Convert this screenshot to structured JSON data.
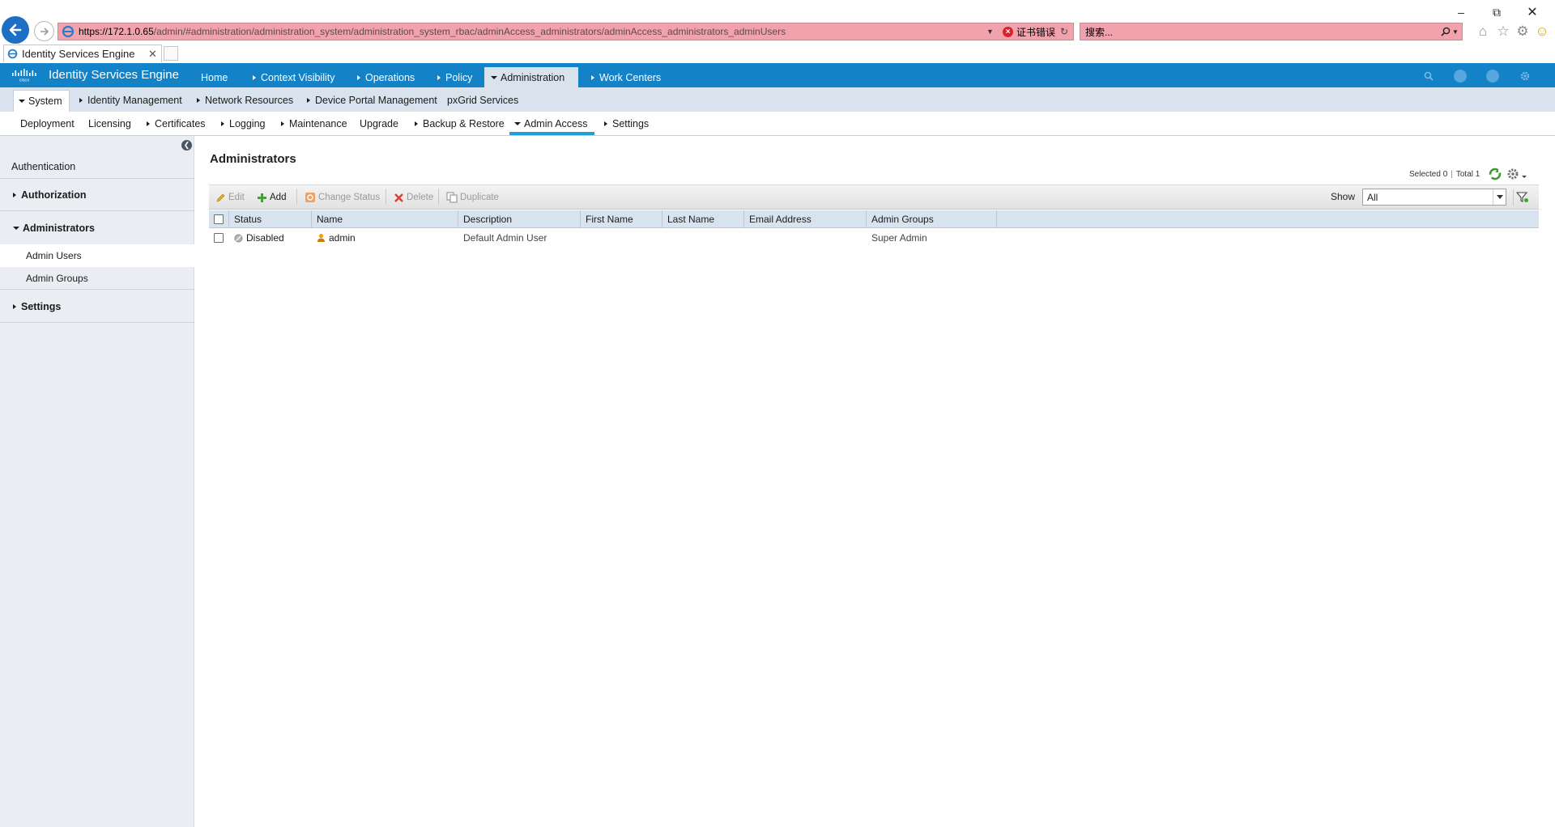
{
  "browser": {
    "url_host": "https://172.1.0.65",
    "url_path": "/admin/#administration/administration_system/administration_system_rbac/adminAccess_administrators/adminAccess_administrators_adminUsers",
    "cert_error": "证书错误",
    "search_placeholder": "搜索...",
    "tab_title": "Identity Services Engine",
    "address_bar_color": "#f2a2ad"
  },
  "app": {
    "brand": "Identity Services Engine",
    "logo_text": "cisco",
    "accent": "#1382c7",
    "nav": [
      {
        "label": "Home"
      },
      {
        "label": "Context Visibility"
      },
      {
        "label": "Operations"
      },
      {
        "label": "Policy"
      },
      {
        "label": "Administration"
      },
      {
        "label": "Work Centers"
      }
    ],
    "subnav": [
      {
        "label": "System"
      },
      {
        "label": "Identity Management"
      },
      {
        "label": "Network Resources"
      },
      {
        "label": "Device Portal Management"
      },
      {
        "label": "pxGrid Services"
      }
    ],
    "thirdnav": [
      {
        "label": "Deployment"
      },
      {
        "label": "Licensing"
      },
      {
        "label": "Certificates"
      },
      {
        "label": "Logging"
      },
      {
        "label": "Maintenance"
      },
      {
        "label": "Upgrade"
      },
      {
        "label": "Backup & Restore"
      },
      {
        "label": "Admin Access"
      },
      {
        "label": "Settings"
      }
    ]
  },
  "sidebar": {
    "items": [
      {
        "label": "Authentication"
      },
      {
        "label": "Authorization"
      },
      {
        "label": "Administrators"
      },
      {
        "label": "Admin Users"
      },
      {
        "label": "Admin Groups"
      },
      {
        "label": "Settings"
      }
    ]
  },
  "main": {
    "title": "Administrators",
    "selected": "Selected 0",
    "total": "Total 1",
    "toolbar": {
      "edit": "Edit",
      "add": "Add",
      "change_status": "Change Status",
      "delete": "Delete",
      "duplicate": "Duplicate",
      "show_label": "Show",
      "show_value": "All"
    },
    "columns": [
      "Status",
      "Name",
      "Description",
      "First Name",
      "Last Name",
      "Email Address",
      "Admin Groups"
    ],
    "rows": [
      {
        "status": "Disabled",
        "name": "admin",
        "description": "Default Admin User",
        "first_name": "",
        "last_name": "",
        "email": "",
        "admin_groups": "Super Admin"
      }
    ]
  }
}
